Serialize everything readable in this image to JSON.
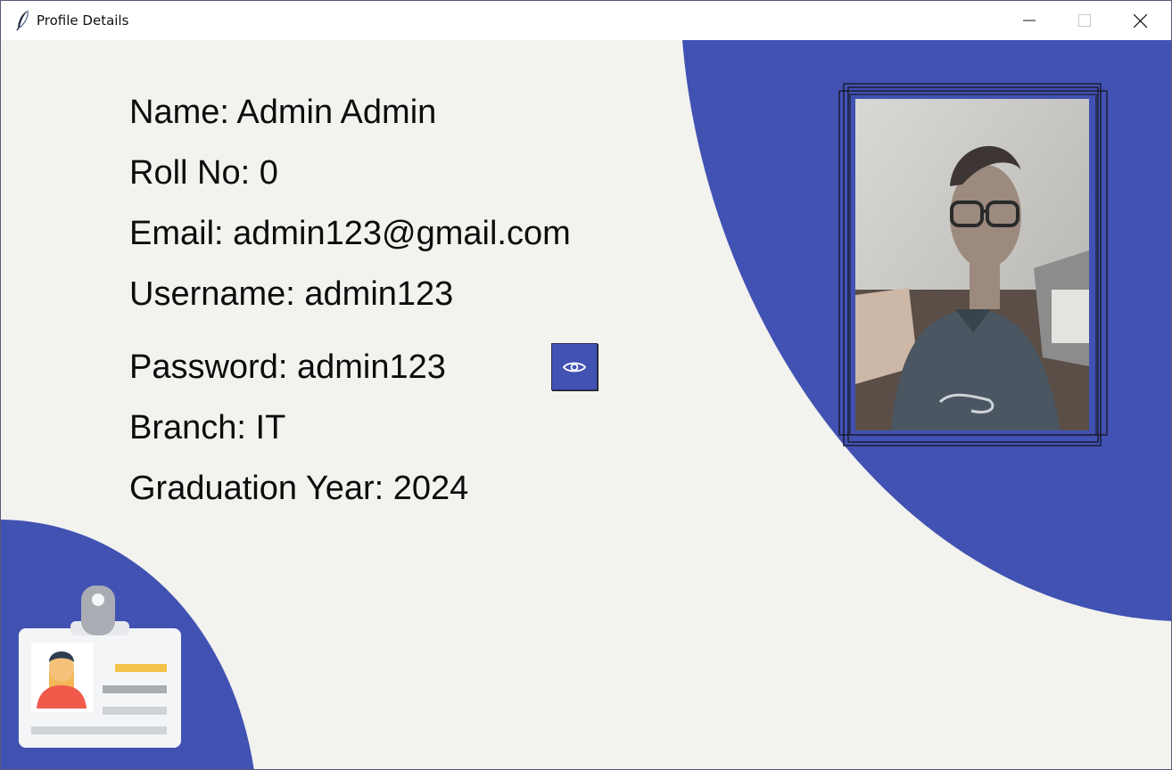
{
  "window": {
    "title": "Profile Details",
    "icon": "feather-icon",
    "controls": [
      "minimize-icon",
      "maximize-icon",
      "close-icon"
    ]
  },
  "profile": {
    "name": "Name: Admin Admin",
    "roll_no": "Roll No: 0",
    "email": "Email: admin123@gmail.com",
    "username": "Username: admin123",
    "password": "Password: admin123",
    "branch": "Branch: IT",
    "graduation_year": "Graduation Year: 2024"
  },
  "password_toggle": {
    "icon": "eye-icon"
  },
  "photo": {
    "description_icon": "profile-photo"
  },
  "decoration": {
    "icon": "id-card-icon"
  },
  "colors": {
    "accent": "#4152b3",
    "background": "#f2f2ef",
    "text": "#0c0c0c"
  }
}
